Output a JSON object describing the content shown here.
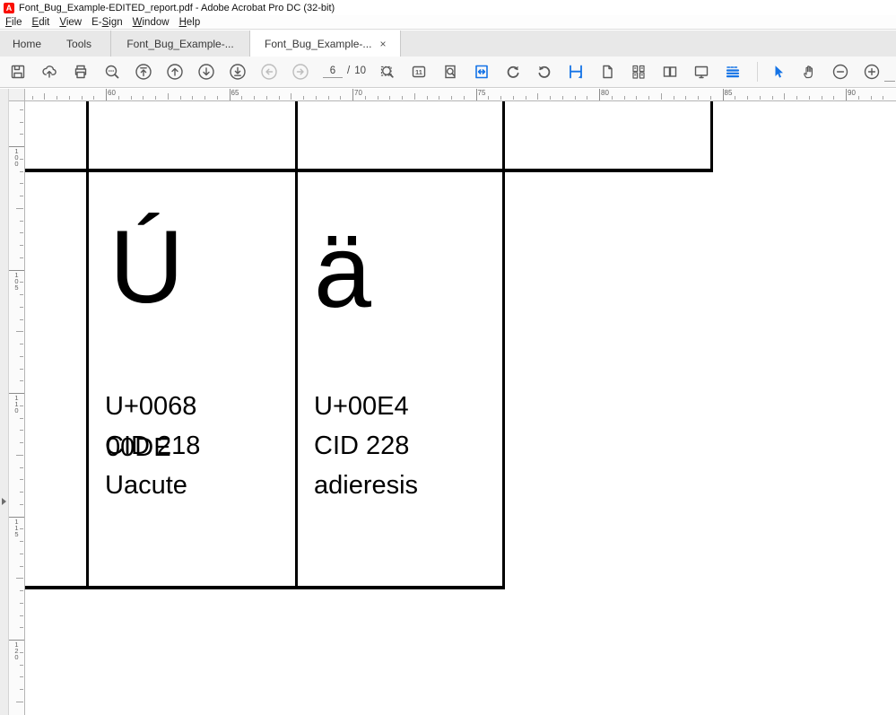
{
  "window": {
    "title": "Font_Bug_Example-EDITED_report.pdf - Adobe Acrobat Pro DC (32-bit)",
    "icon_glyph": "A"
  },
  "menu": {
    "items": [
      {
        "label": "File",
        "mnemonic": 0
      },
      {
        "label": "Edit",
        "mnemonic": 0
      },
      {
        "label": "View",
        "mnemonic": 0
      },
      {
        "label": "E-Sign",
        "mnemonic": 2
      },
      {
        "label": "Window",
        "mnemonic": 0
      },
      {
        "label": "Help",
        "mnemonic": 0
      }
    ]
  },
  "tabs": {
    "home": "Home",
    "tools": "Tools",
    "close_glyph": "×",
    "documents": [
      {
        "label": "Font_Bug_Example-...",
        "active": false
      },
      {
        "label": "Font_Bug_Example-...",
        "active": true
      }
    ]
  },
  "toolbar": {
    "page_current": "6",
    "page_divider": "/",
    "page_total": "10",
    "actual_size_label": "11",
    "accent_color": "#1473e6",
    "icon_names": [
      "save-icon",
      "share-cloud-icon",
      "print-icon",
      "find-icon",
      "first-page-icon",
      "previous-page-icon",
      "next-page-icon",
      "last-page-icon",
      "previous-view-icon",
      "next-view-icon",
      "marquee-zoom-icon",
      "actual-size-icon",
      "fit-page-icon",
      "fit-width-icon",
      "rotate-clockwise-icon",
      "rotate-counterclockwise-icon",
      "continuous-scroll-icon",
      "single-page-icon",
      "page-thumbnails-icon",
      "two-page-view-icon",
      "full-screen-icon",
      "reading-mode-icon",
      "select-tool-icon",
      "hand-tool-icon",
      "zoom-out-icon",
      "zoom-in-icon"
    ]
  },
  "rulers": {
    "horizontal_labels": [
      "60",
      "65",
      "70",
      "75",
      "80",
      "85",
      "90"
    ],
    "vertical_labels": [
      "100",
      "105",
      "110",
      "115",
      "120"
    ]
  },
  "page": {
    "cells": [
      {
        "glyph": "Ú",
        "unicode_line": "U+0068",
        "cid_line": "CID 218",
        "overlap_text": "00DE",
        "name_line": "Uacute"
      },
      {
        "glyph": "ä",
        "unicode_line": "U+00E4",
        "cid_line": "CID 228",
        "name_line": "adieresis"
      }
    ]
  }
}
